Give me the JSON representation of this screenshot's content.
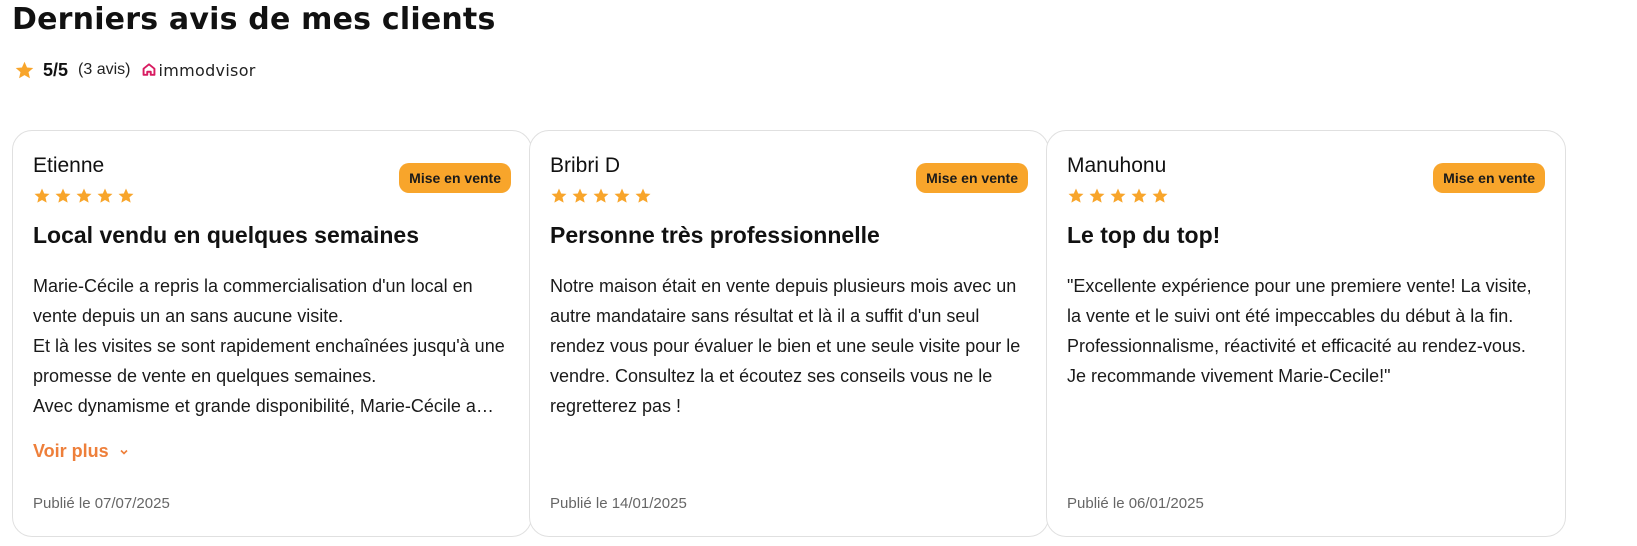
{
  "header": {
    "title": "Derniers avis de mes clients",
    "rating": "5/5",
    "count": "(3 avis)",
    "provider": "immodvisor"
  },
  "colors": {
    "star": "#f8a52b",
    "badge": "#f8a52b",
    "more_link": "#ee7f3a",
    "provider_icon": "#d81b60"
  },
  "reviews": [
    {
      "author": "Etienne",
      "stars": 5,
      "badge": "Mise en vente",
      "title": "Local vendu en quelques semaines",
      "body": "Marie-Cécile a repris la commercialisation d'un local en vente depuis un an sans aucune visite.\nEt là les visites se sont rapidement enchaînées jusqu'à une promesse de vente en quelques semaines.\nAvec dynamisme et grande disponibilité, Marie-Cécile a assuré le suivi jusqu'à la signature.",
      "more_label": "Voir plus",
      "date": "Publié le 07/07/2025"
    },
    {
      "author": "Bribri D",
      "stars": 5,
      "badge": "Mise en vente",
      "title": "Personne très professionnelle",
      "body": "Notre maison était en vente depuis plusieurs mois avec un autre mandataire sans résultat et là il a suffit d'un seul rendez vous pour évaluer le bien et une seule visite pour le vendre. Consultez la et écoutez ses conseils vous ne le regretterez pas !",
      "date": "Publié le 14/01/2025"
    },
    {
      "author": "Manuhonu",
      "stars": 5,
      "badge": "Mise en vente",
      "title": "Le top du top!",
      "body": "\"Excellente expérience pour une premiere vente! La visite, la vente et le suivi ont été impeccables du début à la fin. Professionnalisme, réactivité et efficacité au rendez-vous. Je recommande vivement Marie-Cecile!\"",
      "date": "Publié le 06/01/2025"
    }
  ]
}
